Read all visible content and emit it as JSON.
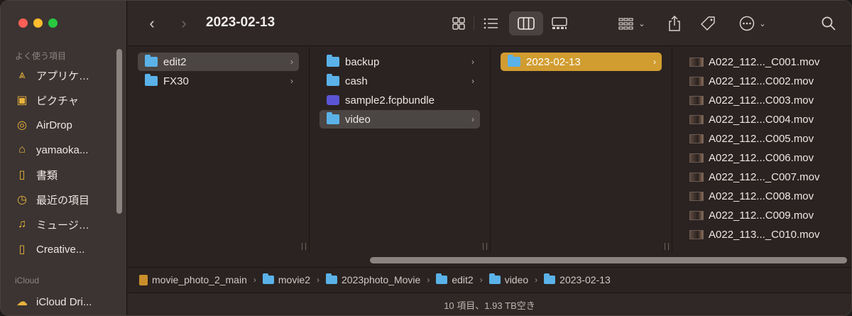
{
  "window": {
    "title": "2023-02-13"
  },
  "sidebar": {
    "favorites_label": "よく使う項目",
    "items": [
      {
        "label": "アプリケ…",
        "icon": "applications-icon"
      },
      {
        "label": "ピクチャ",
        "icon": "pictures-icon"
      },
      {
        "label": "AirDrop",
        "icon": "airdrop-icon"
      },
      {
        "label": "yamaoka...",
        "icon": "home-icon"
      },
      {
        "label": "書類",
        "icon": "documents-icon"
      },
      {
        "label": "最近の項目",
        "icon": "recents-icon"
      },
      {
        "label": "ミュージ…",
        "icon": "music-icon"
      },
      {
        "label": "Creative...",
        "icon": "document-icon"
      }
    ],
    "icloud_label": "iCloud",
    "icloud_items": [
      {
        "label": "iCloud Dri...",
        "icon": "cloud-icon"
      }
    ]
  },
  "columns": [
    {
      "items": [
        {
          "label": "edit2",
          "type": "folder",
          "selected": true
        },
        {
          "label": "FX30",
          "type": "folder",
          "selected": false
        }
      ]
    },
    {
      "items": [
        {
          "label": "backup",
          "type": "folder",
          "selected": false
        },
        {
          "label": "cash",
          "type": "folder",
          "selected": false
        },
        {
          "label": "sample2.fcpbundle",
          "type": "bundle",
          "selected": false
        },
        {
          "label": "video",
          "type": "folder",
          "selected": true
        }
      ]
    },
    {
      "items": [
        {
          "label": "2023-02-13",
          "type": "folder",
          "selected": true
        }
      ]
    },
    {
      "items": [
        {
          "label": "A022_112..._C001.mov",
          "type": "video"
        },
        {
          "label": "A022_112...C002.mov",
          "type": "video"
        },
        {
          "label": "A022_112...C003.mov",
          "type": "video"
        },
        {
          "label": "A022_112...C004.mov",
          "type": "video"
        },
        {
          "label": "A022_112...C005.mov",
          "type": "video"
        },
        {
          "label": "A022_112...C006.mov",
          "type": "video"
        },
        {
          "label": "A022_112..._C007.mov",
          "type": "video"
        },
        {
          "label": "A022_112...C008.mov",
          "type": "video"
        },
        {
          "label": "A022_112...C009.mov",
          "type": "video"
        },
        {
          "label": "A022_113..._C010.mov",
          "type": "video"
        }
      ]
    }
  ],
  "pathbar": {
    "items": [
      "movie_photo_2_main",
      "movie2",
      "2023photo_Movie",
      "edit2",
      "video",
      "2023-02-13"
    ]
  },
  "status": {
    "text": "10 項目、1.93 TB空き"
  },
  "colors": {
    "selection_gold": "#d19c30",
    "folder_blue": "#5ab2e8",
    "sidebar_icon": "#e9b23b"
  }
}
